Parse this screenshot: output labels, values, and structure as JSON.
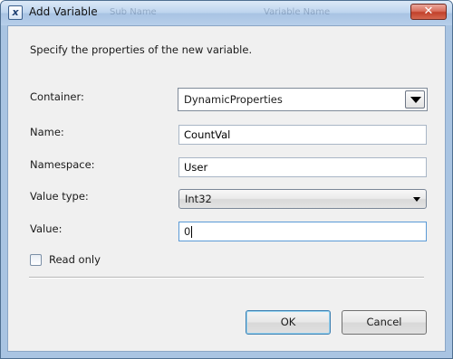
{
  "window": {
    "title": "Add Variable",
    "background_ghost_texts": [
      "Sub Name",
      "Variable Name"
    ]
  },
  "intro": "Specify the properties of the new variable.",
  "form": {
    "container": {
      "label": "Container:",
      "value": "DynamicProperties"
    },
    "name": {
      "label": "Name:",
      "value": "CountVal"
    },
    "namespace": {
      "label": "Namespace:",
      "value": "User"
    },
    "value_type": {
      "label": "Value type:",
      "value": "Int32"
    },
    "value": {
      "label": "Value:",
      "value": "0"
    },
    "read_only": {
      "label": "Read only",
      "checked": false
    }
  },
  "buttons": {
    "ok": "OK",
    "cancel": "Cancel"
  },
  "icons": {
    "app": "variable-icon",
    "close": "close-icon",
    "dropdown": "chevron-down-icon"
  },
  "colors": {
    "titlebar": "#bdd4ee",
    "close_button": "#c1412b",
    "client_bg": "#f0f0f0",
    "focus_border": "#5a9ad6"
  }
}
